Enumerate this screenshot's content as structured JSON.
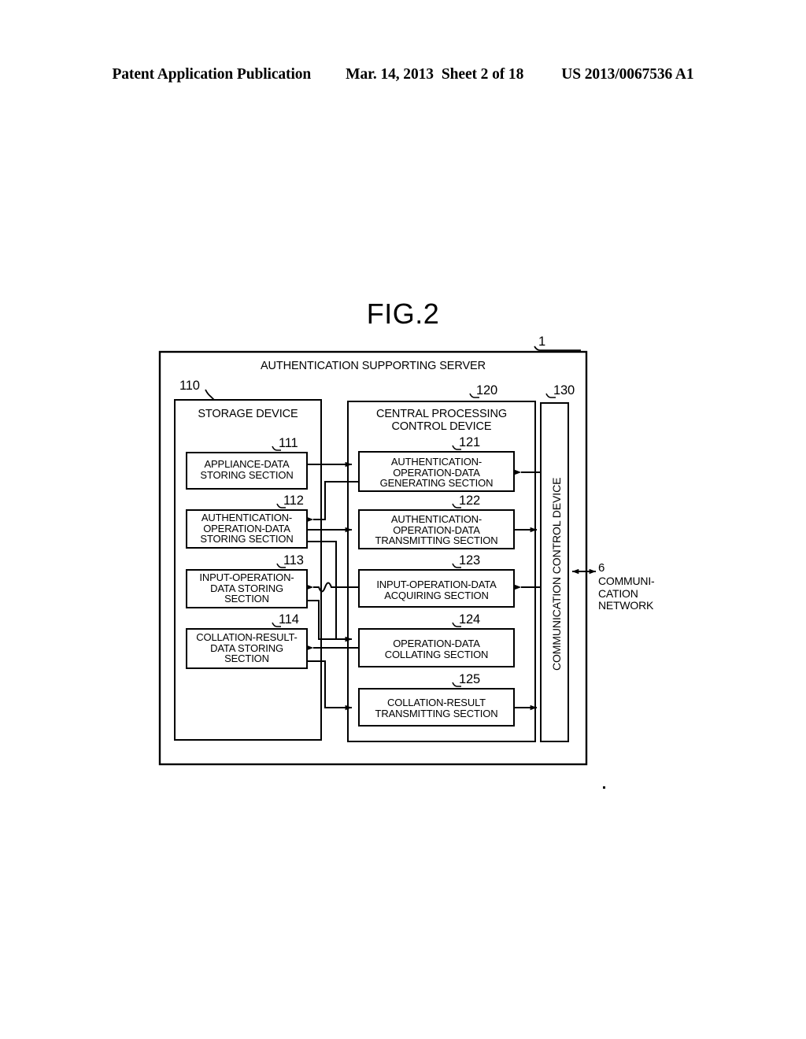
{
  "header": {
    "publication": "Patent Application Publication",
    "date": "Mar. 14, 2013",
    "sheet": "Sheet 2 of 18",
    "patent_number": "US 2013/0067536 A1"
  },
  "figure": {
    "title": "FIG.2",
    "outer": {
      "ref": "1",
      "label": "AUTHENTICATION SUPPORTING SERVER"
    },
    "storage_device": {
      "ref": "110",
      "label": "STORAGE DEVICE",
      "sections": [
        {
          "ref": "111",
          "label": "APPLIANCE-DATA\nSTORING SECTION"
        },
        {
          "ref": "112",
          "label": "AUTHENTICATION-\nOPERATION-DATA\nSTORING SECTION"
        },
        {
          "ref": "113",
          "label": "INPUT-OPERATION-\nDATA STORING\nSECTION"
        },
        {
          "ref": "114",
          "label": "COLLATION-RESULT-\nDATA STORING\nSECTION"
        }
      ]
    },
    "central_processing": {
      "ref": "120",
      "label": "CENTRAL PROCESSING\nCONTROL DEVICE",
      "sections": [
        {
          "ref": "121",
          "label": "AUTHENTICATION-\nOPERATION-DATA\nGENERATING SECTION"
        },
        {
          "ref": "122",
          "label": "AUTHENTICATION-\nOPERATION-DATA\nTRANSMITTING SECTION"
        },
        {
          "ref": "123",
          "label": "INPUT-OPERATION-DATA\nACQUIRING SECTION"
        },
        {
          "ref": "124",
          "label": "OPERATION-DATA\nCOLLATING SECTION"
        },
        {
          "ref": "125",
          "label": "COLLATION-RESULT\nTRANSMITTING SECTION"
        }
      ]
    },
    "communication_control_device": {
      "ref": "130",
      "label": "COMMUNICATION CONTROL DEVICE"
    },
    "network": {
      "ref": "6",
      "label": "COMMUNI-\nCATION\nNETWORK"
    },
    "colors": {
      "line": "#000000",
      "background": "#ffffff"
    }
  }
}
